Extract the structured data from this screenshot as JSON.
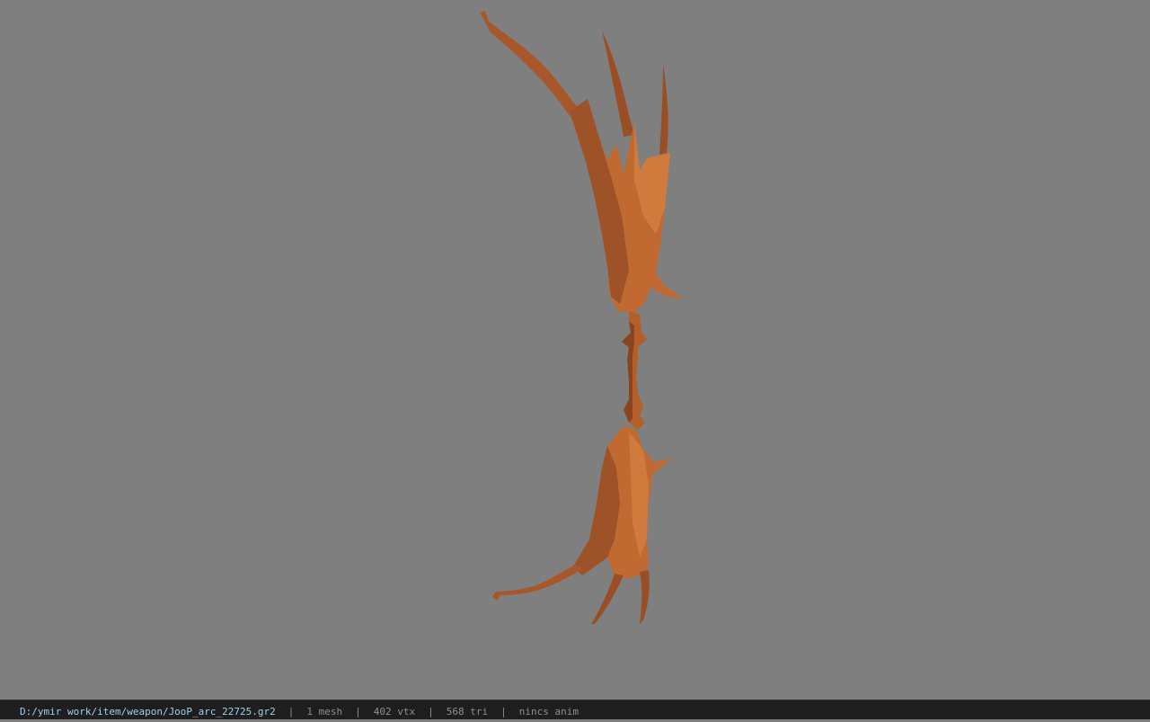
{
  "viewport": {
    "background_color": "#7f7f7f",
    "model_color": "#c06a32",
    "model_shadow_color": "#8a4520",
    "model_highlight_color": "#d98a4e"
  },
  "status_bar": {
    "file_path": "D:/ymir work/item/weapon/JooP_arc_22725.gr2",
    "separator": "|",
    "mesh_count": "1 mesh",
    "vertex_count": "402 vtx",
    "triangle_count": "568 tri",
    "animation": "nincs anim"
  }
}
